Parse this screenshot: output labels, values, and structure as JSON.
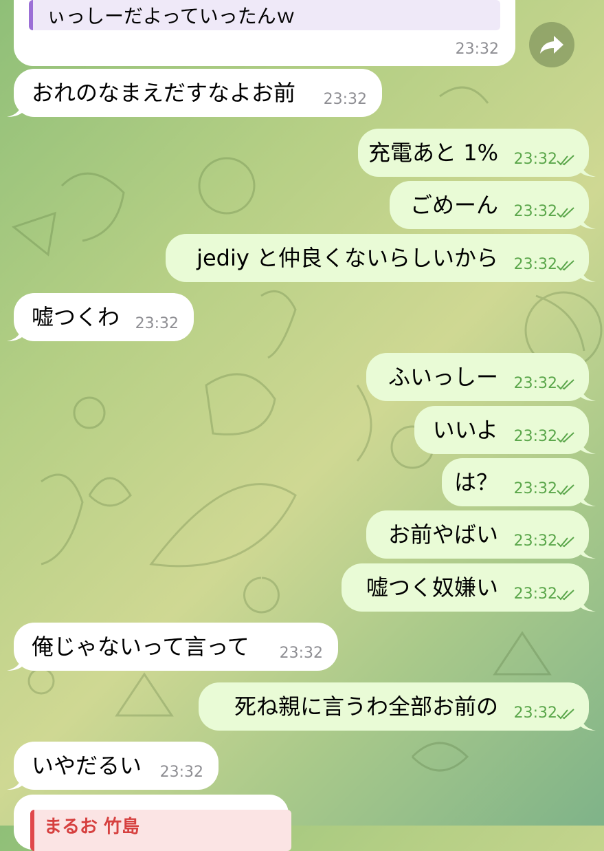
{
  "top_message": {
    "quote_text": "ぃっしーだよっていったんｗ",
    "time": "23:32"
  },
  "messages": [
    {
      "dir": "in",
      "text": "おれのなまえだすなよお前",
      "time": "23:32"
    },
    {
      "dir": "out",
      "text": "充電あと 1%",
      "time": "23:32"
    },
    {
      "dir": "out",
      "text": "ごめーん",
      "time": "23:32"
    },
    {
      "dir": "out",
      "text": "jediy と仲良くないらしいから",
      "time": "23:32"
    },
    {
      "dir": "in",
      "text": "嘘つくわ",
      "time": "23:32"
    },
    {
      "dir": "out",
      "text": "ふいっしー",
      "time": "23:32"
    },
    {
      "dir": "out",
      "text": "いいよ",
      "time": "23:32"
    },
    {
      "dir": "out",
      "text": "は？",
      "time": "23:32"
    },
    {
      "dir": "out",
      "text": "お前やばい",
      "time": "23:32"
    },
    {
      "dir": "out",
      "text": "嘘つく奴嫌い",
      "time": "23:32"
    },
    {
      "dir": "in",
      "text": "俺じゃないって言って",
      "time": "23:32"
    },
    {
      "dir": "out",
      "text": "死ね親に言うわ全部お前の",
      "time": "23:32"
    },
    {
      "dir": "in",
      "text": "いやだるい",
      "time": "23:32"
    }
  ],
  "bottom_message": {
    "quote_author": "まるお 竹島"
  },
  "icons": {
    "forward": "forward-arrow-icon",
    "read_receipt": "double-check-icon"
  },
  "colors": {
    "incoming_bubble": "#ffffff",
    "outgoing_bubble": "#e9fbd6",
    "outgoing_time": "#5aa64a",
    "incoming_time": "#8e8e93",
    "quote_accent_purple": "#9b6fd6",
    "quote_accent_red": "#e0484a"
  }
}
